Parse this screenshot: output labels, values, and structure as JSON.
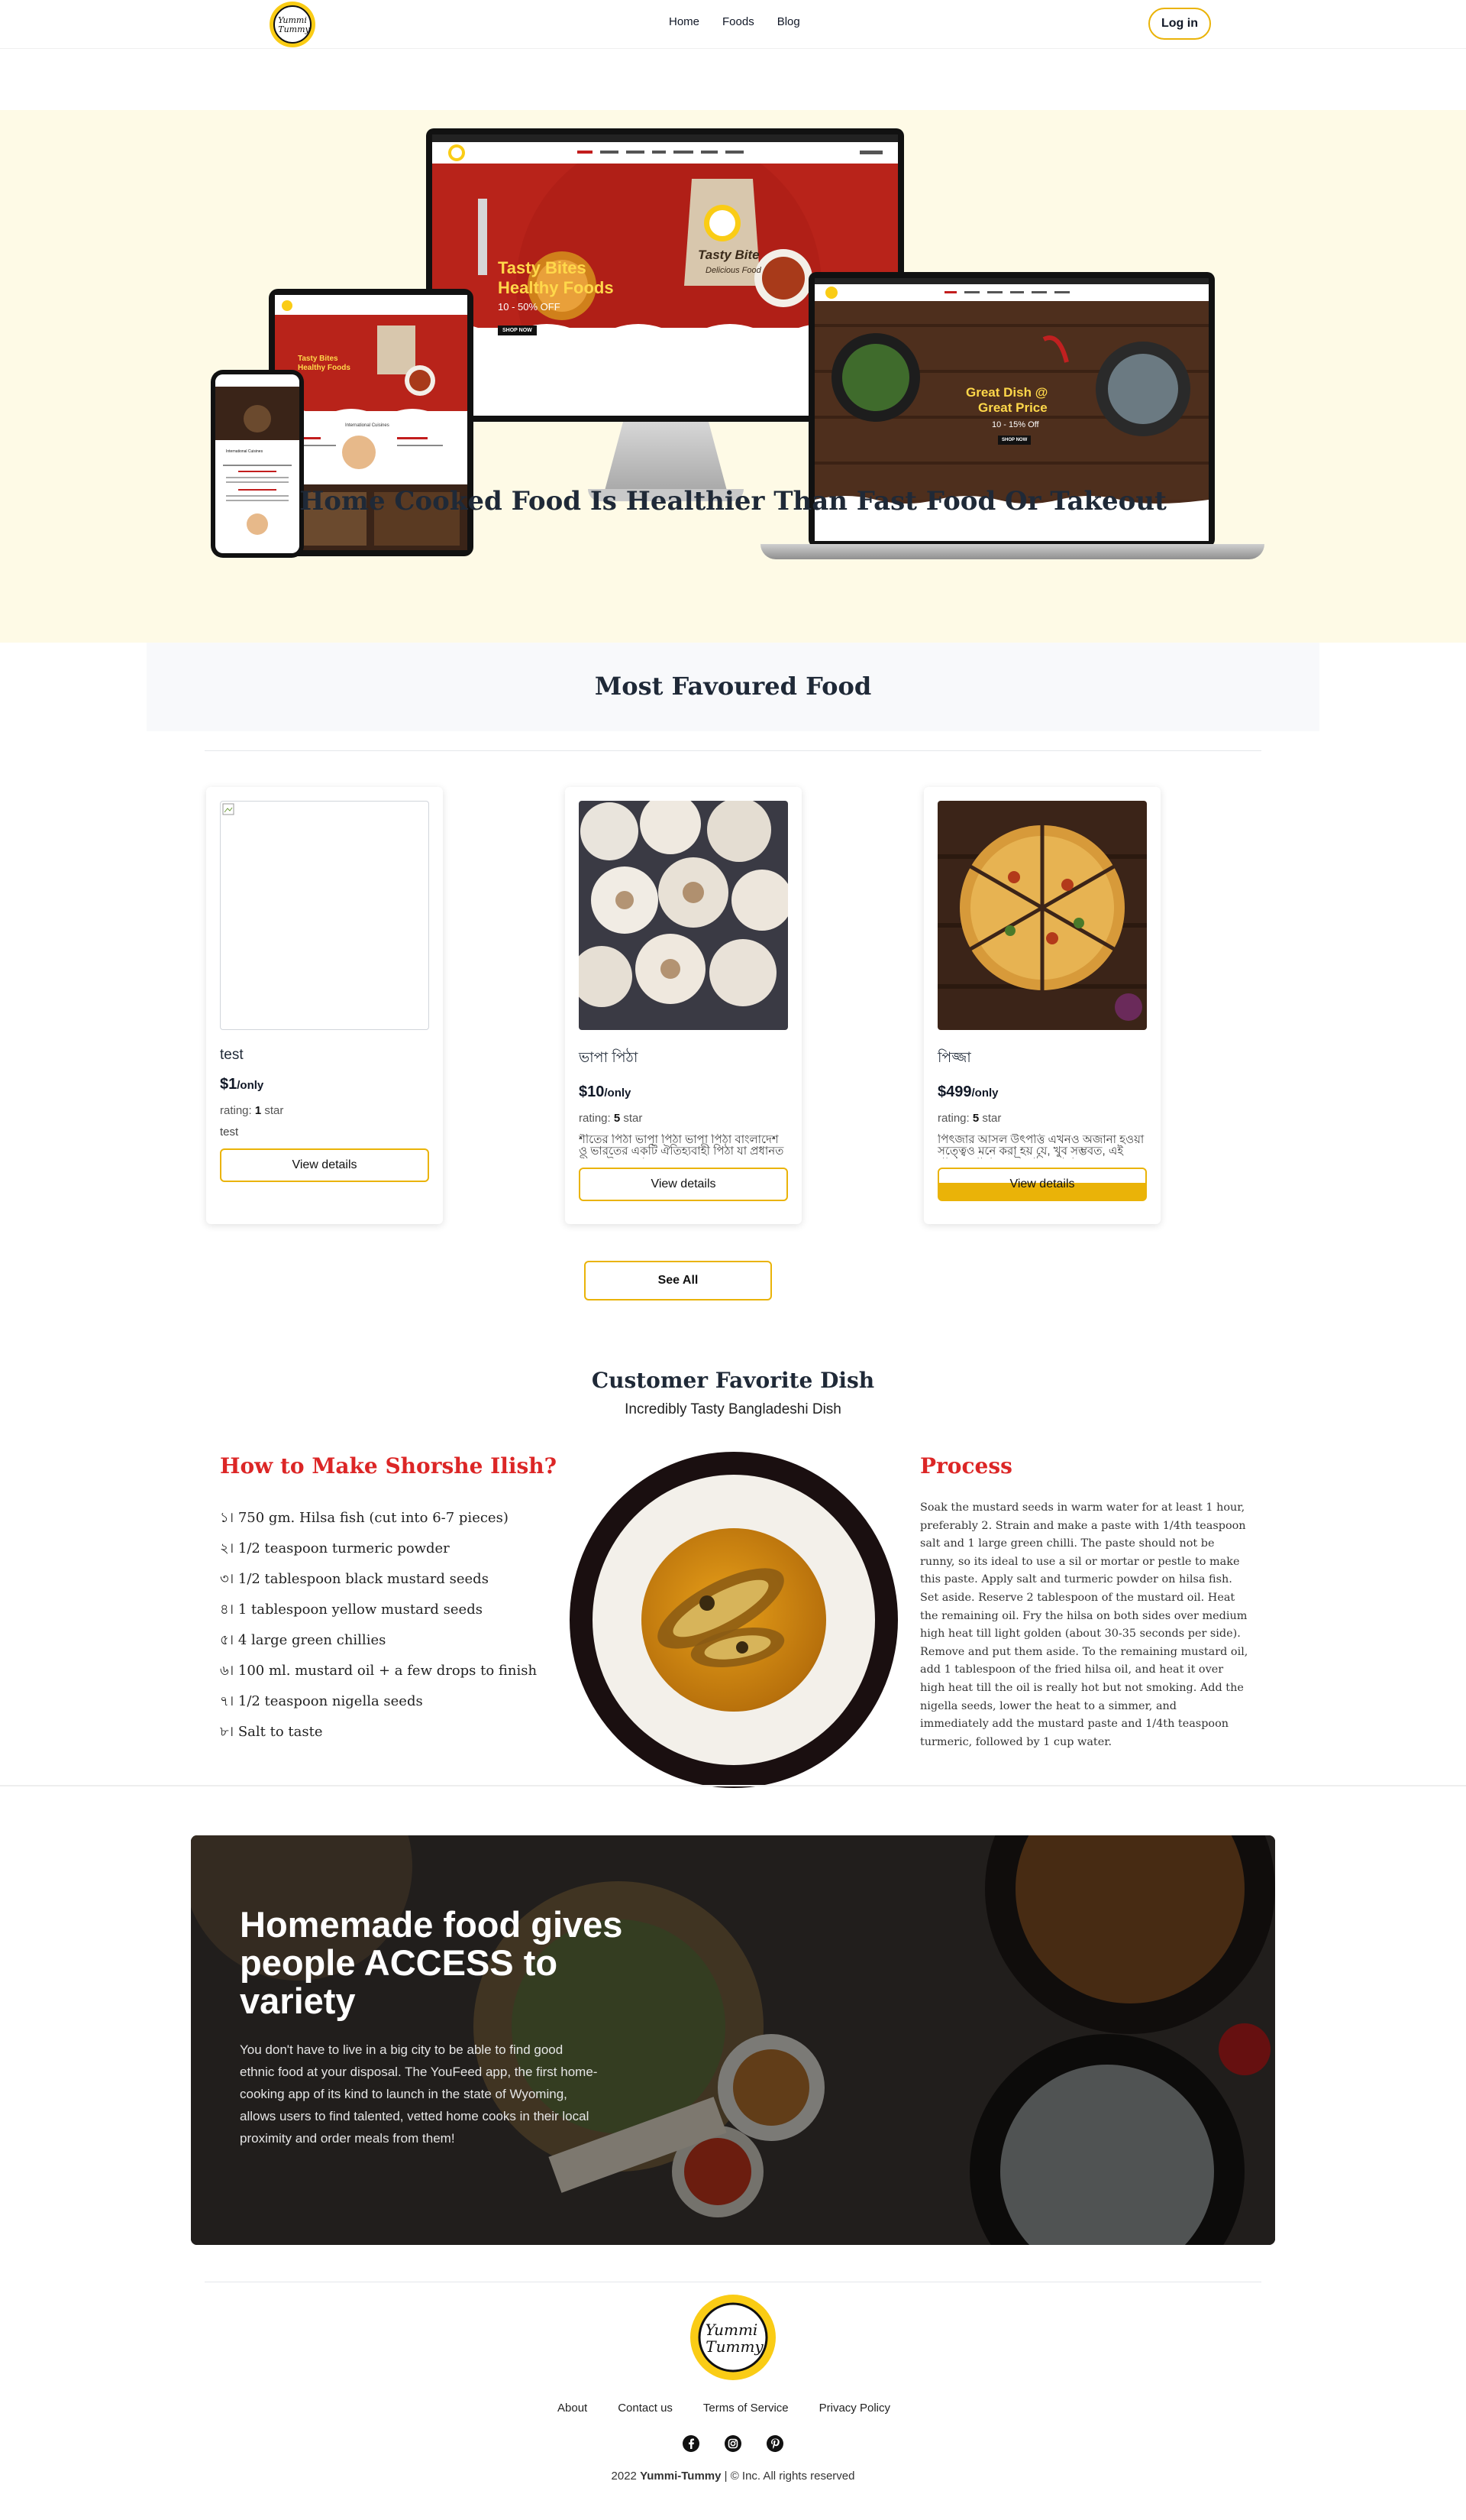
{
  "header": {
    "logo_text_1": "Yummi",
    "logo_text_2": "Tummy",
    "nav": [
      "Home",
      "Foods",
      "Blog"
    ],
    "login_label": "Log in"
  },
  "hero": {
    "title": "Home Cooked Food Is Healthier Than Fast Food Or Takeout",
    "mockup": {
      "monitor_headline_1": "Tasty Bites",
      "monitor_headline_2": "Healthy Foods",
      "monitor_offer": "10 - 50% OFF",
      "monitor_cta": "SHOP NOW",
      "laptop_headline_1": "Great Dish @",
      "laptop_headline_2": "Great Price",
      "laptop_offer": "10 - 15% Off",
      "laptop_cta": "SHOP NOW",
      "tablet_headline_1": "Tasty Bites",
      "tablet_headline_2": "Healthy Foods",
      "tablet_section": "International Cuisines",
      "phone_section": "International Cuisines",
      "bag_text_1": "Tasty Bite",
      "bag_text_2": "Delicious Food"
    }
  },
  "favoured": {
    "title": "Most Favoured Food",
    "cards": [
      {
        "name": "test",
        "price": "$1",
        "unit": "/only",
        "rating_prefix": "rating: ",
        "rating": "1",
        "rating_suffix": " star",
        "desc": "test",
        "button": "View details"
      },
      {
        "name": "ভাপা পিঠা",
        "price": "$10",
        "unit": "/only",
        "rating_prefix": "rating: ",
        "rating": "5",
        "rating_suffix": " star",
        "desc": "শীতের পিঠা ভাপা পিঠা ভাপা পিঠা বাংলাদেশ ও ভারতের একটি ঐতিহ্যবাহী পিঠা যা প্রধানত শীত মৌসুমে প্রস্তু...",
        "button": "View details"
      },
      {
        "name": "পিজ্জা",
        "price": "$499",
        "unit": "/only",
        "rating_prefix": "rating: ",
        "rating": "5",
        "rating_suffix": " star",
        "desc": "পিৎজার আসল উৎপত্তি এখনও অজানা হওয়া সত্ত্বেও মনে করা হয় যে, খুব সম্ভবত, এই খাবারে খাবারের উৎপত্তি রোমা...",
        "button": "View details"
      }
    ],
    "see_all": "See All"
  },
  "customer_favorite": {
    "title": "Customer Favorite Dish",
    "subtitle": "Incredibly Tasty Bangladeshi Dish",
    "recipe_title": "How to Make Shorshe Ilish?",
    "ingredients": [
      "১। 750 gm. Hilsa fish (cut into 6-7 pieces)",
      "২। 1/2 teaspoon turmeric powder",
      "৩। 1/2 tablespoon black mustard seeds",
      "৪। 1 tablespoon yellow mustard seeds",
      "৫। 4 large green chillies",
      "৬। 100 ml. mustard oil + a few drops to finish",
      "৭। 1/2 teaspoon nigella seeds",
      "৮। Salt to taste"
    ],
    "process_title": "Process",
    "process_text": "Soak the mustard seeds in warm water for at least 1 hour, preferably 2. Strain and make a paste with 1/4th teaspoon salt and 1 large green chilli. The paste should not be runny, so its ideal to use a sil or mortar or pestle to make this paste. Apply salt and turmeric powder on hilsa fish. Set aside. Reserve 2 tablespoon of the mustard oil. Heat the remaining oil. Fry the hilsa on both sides over medium high heat till light golden (about 30-35 seconds per side). Remove and put them aside. To the remaining mustard oil, add 1 tablespoon of the fried hilsa oil, and heat it over high heat till the oil is really hot but not smoking. Add the nigella seeds, lower the heat to a simmer, and immediately add the mustard paste and 1/4th teaspoon turmeric, followed by 1 cup water."
  },
  "banner": {
    "title": "Homemade food gives people ACCESS to variety",
    "text": "You don't have to live in a big city to be able to find good ethnic food at your disposal. The YouFeed app, the first home-cooking app of its kind to launch in the state of Wyoming, allows users to find talented, vetted home cooks in their local proximity and order meals from them!"
  },
  "footer": {
    "links": [
      "About",
      "Contact us",
      "Terms of Service",
      "Privacy Policy"
    ],
    "social_icons": [
      "facebook-icon",
      "instagram-icon",
      "pinterest-icon"
    ],
    "copyright_year": "2022",
    "copyright_brand": "Yummi-Tummy",
    "copyright_rest": " | © Inc. All rights reserved"
  },
  "colors": {
    "accent": "#eab308",
    "hero_bg": "#fefae6",
    "recipe_red": "#dc2626"
  }
}
